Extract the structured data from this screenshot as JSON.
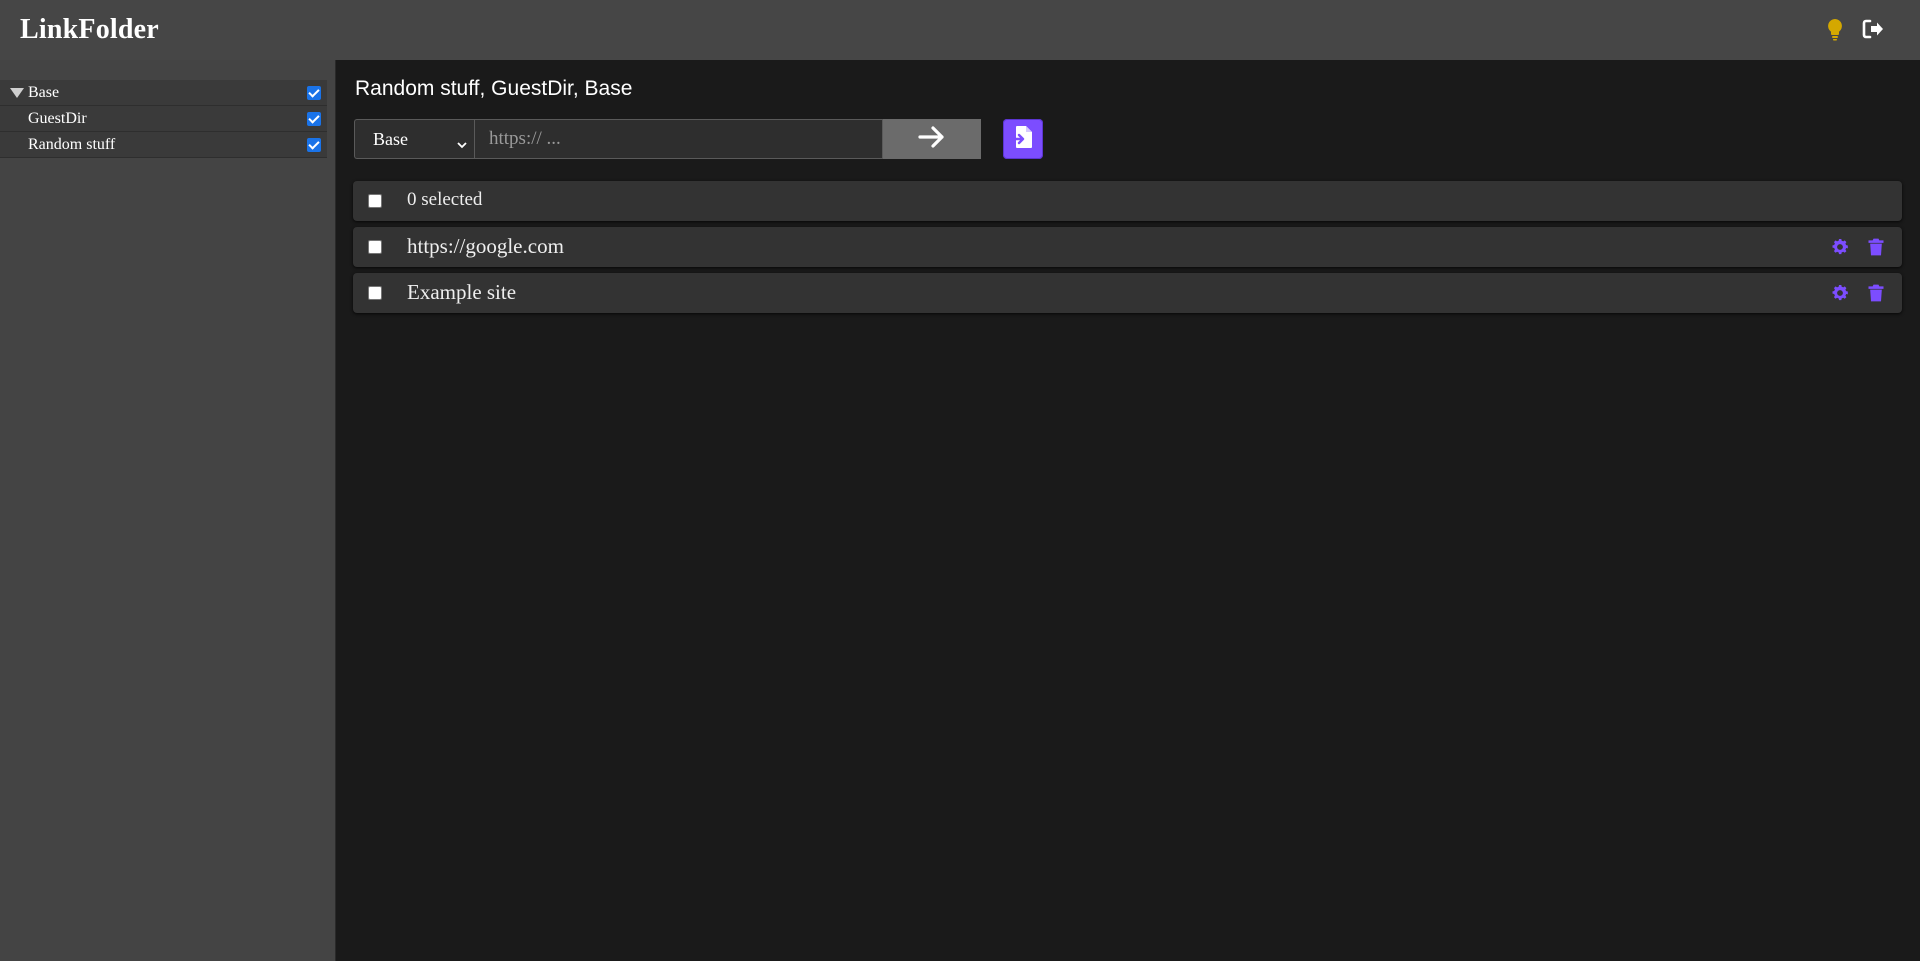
{
  "app": {
    "title": "LinkFolder"
  },
  "header_icons": {
    "theme": "lightbulb-icon",
    "logout": "logout-icon",
    "theme_color": "#e0b400"
  },
  "sidebar": {
    "items": [
      {
        "label": "Base",
        "checked": true,
        "expanded": true
      },
      {
        "label": "GuestDir",
        "checked": true
      },
      {
        "label": "Random stuff",
        "checked": true
      }
    ]
  },
  "main": {
    "breadcrumb": "Random stuff, GuestDir, Base",
    "folder_select": {
      "value": "Base"
    },
    "url_input": {
      "placeholder": "https:// ..."
    },
    "accent_color": "#7c4dff",
    "select_all": {
      "label": "0 selected",
      "checked": false
    },
    "links": [
      {
        "title": "https://google.com",
        "checked": false
      },
      {
        "title": "Example site",
        "checked": false
      }
    ]
  }
}
